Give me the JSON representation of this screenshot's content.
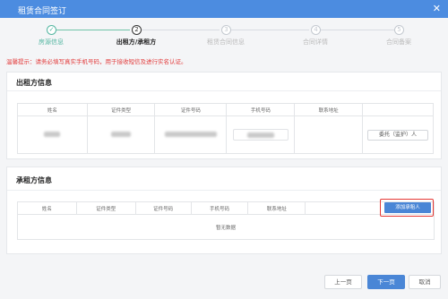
{
  "window": {
    "title": "租赁合同签订",
    "close_glyph": "✕"
  },
  "steps": [
    {
      "number": "✓",
      "label": "房源信息",
      "state": "done"
    },
    {
      "number": "2",
      "label": "出租方/承租方",
      "state": "active"
    },
    {
      "number": "3",
      "label": "租赁合同信息",
      "state": "pending"
    },
    {
      "number": "4",
      "label": "合同详情",
      "state": "pending"
    },
    {
      "number": "5",
      "label": "合同备案",
      "state": "pending"
    }
  ],
  "tip": "温馨提示：请务必填写真实手机号码，用于接收短信及进行实名认证。",
  "lessor": {
    "title": "出租方信息",
    "columns": [
      "姓名",
      "证件类型",
      "证件号码",
      "手机号码",
      "联系地址",
      ""
    ],
    "delegate_button": "委托（监护）人"
  },
  "lessee": {
    "title": "承租方信息",
    "columns": [
      "姓名",
      "证件类型",
      "证件号码",
      "手机号码",
      "联系地址"
    ],
    "add_button": "添加承租人",
    "empty_text": "暂无数据"
  },
  "footer": {
    "prev": "上一页",
    "next": "下一页",
    "cancel": "取消"
  },
  "colors": {
    "accent": "#4a86d6",
    "success": "#53b6a1",
    "warning": "#e23b3b",
    "highlight": "#e53935"
  }
}
